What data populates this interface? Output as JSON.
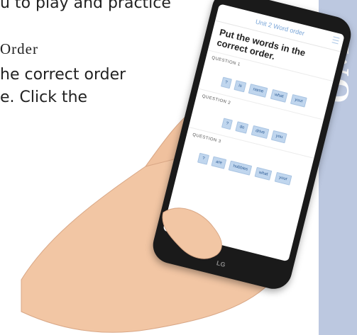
{
  "page": {
    "line1": "u to play and practice",
    "line2": "Order",
    "line3": "he correct order",
    "line4": "e. Click the"
  },
  "side_tab": {
    "letters": "WO"
  },
  "phone": {
    "brand": "LG",
    "app": {
      "title": "Unit 2 Word order",
      "instruction": "Put the words in the correct order.",
      "questions": [
        {
          "label": "QUESTION 1",
          "words": [
            "?",
            "is",
            "name",
            "what",
            "your"
          ]
        },
        {
          "label": "QUESTION 2",
          "words": [
            "?",
            "do",
            "drive",
            "you"
          ]
        },
        {
          "label": "QUESTION 3",
          "words": [
            "?",
            "are",
            "hobbies",
            "what",
            "your"
          ]
        }
      ]
    }
  },
  "colors": {
    "side_tab": "#bcc8e0",
    "chip_bg": "#c0d6ee",
    "header_text": "#7aa6d8"
  }
}
